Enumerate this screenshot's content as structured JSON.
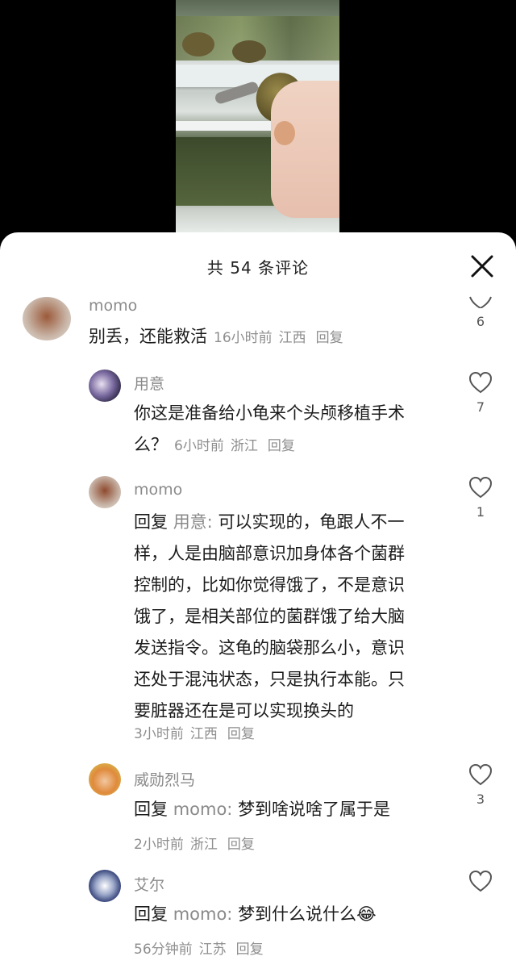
{
  "header": {
    "title": "共 54 条评论"
  },
  "comments": [
    {
      "user": "momo",
      "text": "别丢，还能救活",
      "time": "16小时前",
      "location": "江西",
      "reply_label": "回复",
      "likes": "6"
    },
    {
      "user": "用意",
      "text_line1": "你这是准备给小龟来个头颅移植手术",
      "text_line2": "么？",
      "time": "6小时前",
      "location": "浙江",
      "reply_label": "回复",
      "likes": "7"
    },
    {
      "user": "momo",
      "reply_prefix": "回复",
      "reply_to": "用意:",
      "lines": [
        "可以实现的，龟跟人不一",
        "样，人是由脑部意识加身体各个菌群",
        "控制的，比如你觉得饿了，不是意识",
        "饿了，是相关部位的菌群饿了给大脑",
        "发送指令。这龟的脑袋那么小，意识",
        "还处于混沌状态，只是执行本能。只",
        "要脏器还在是可以实现换头的"
      ],
      "time": "3小时前",
      "location": "江西",
      "reply_label": "回复",
      "likes": "1"
    },
    {
      "user": "威勋烈马",
      "reply_prefix": "回复",
      "reply_to": "momo:",
      "text": "梦到啥说啥了属于是",
      "time": "2小时前",
      "location": "浙江",
      "reply_label": "回复",
      "likes": "3"
    },
    {
      "user": "艾尔",
      "reply_prefix": "回复",
      "reply_to": "momo:",
      "text": "梦到什么说什么",
      "emoji": "😂",
      "time": "56分钟前",
      "location": "江苏",
      "reply_label": "回复",
      "likes": ""
    }
  ]
}
